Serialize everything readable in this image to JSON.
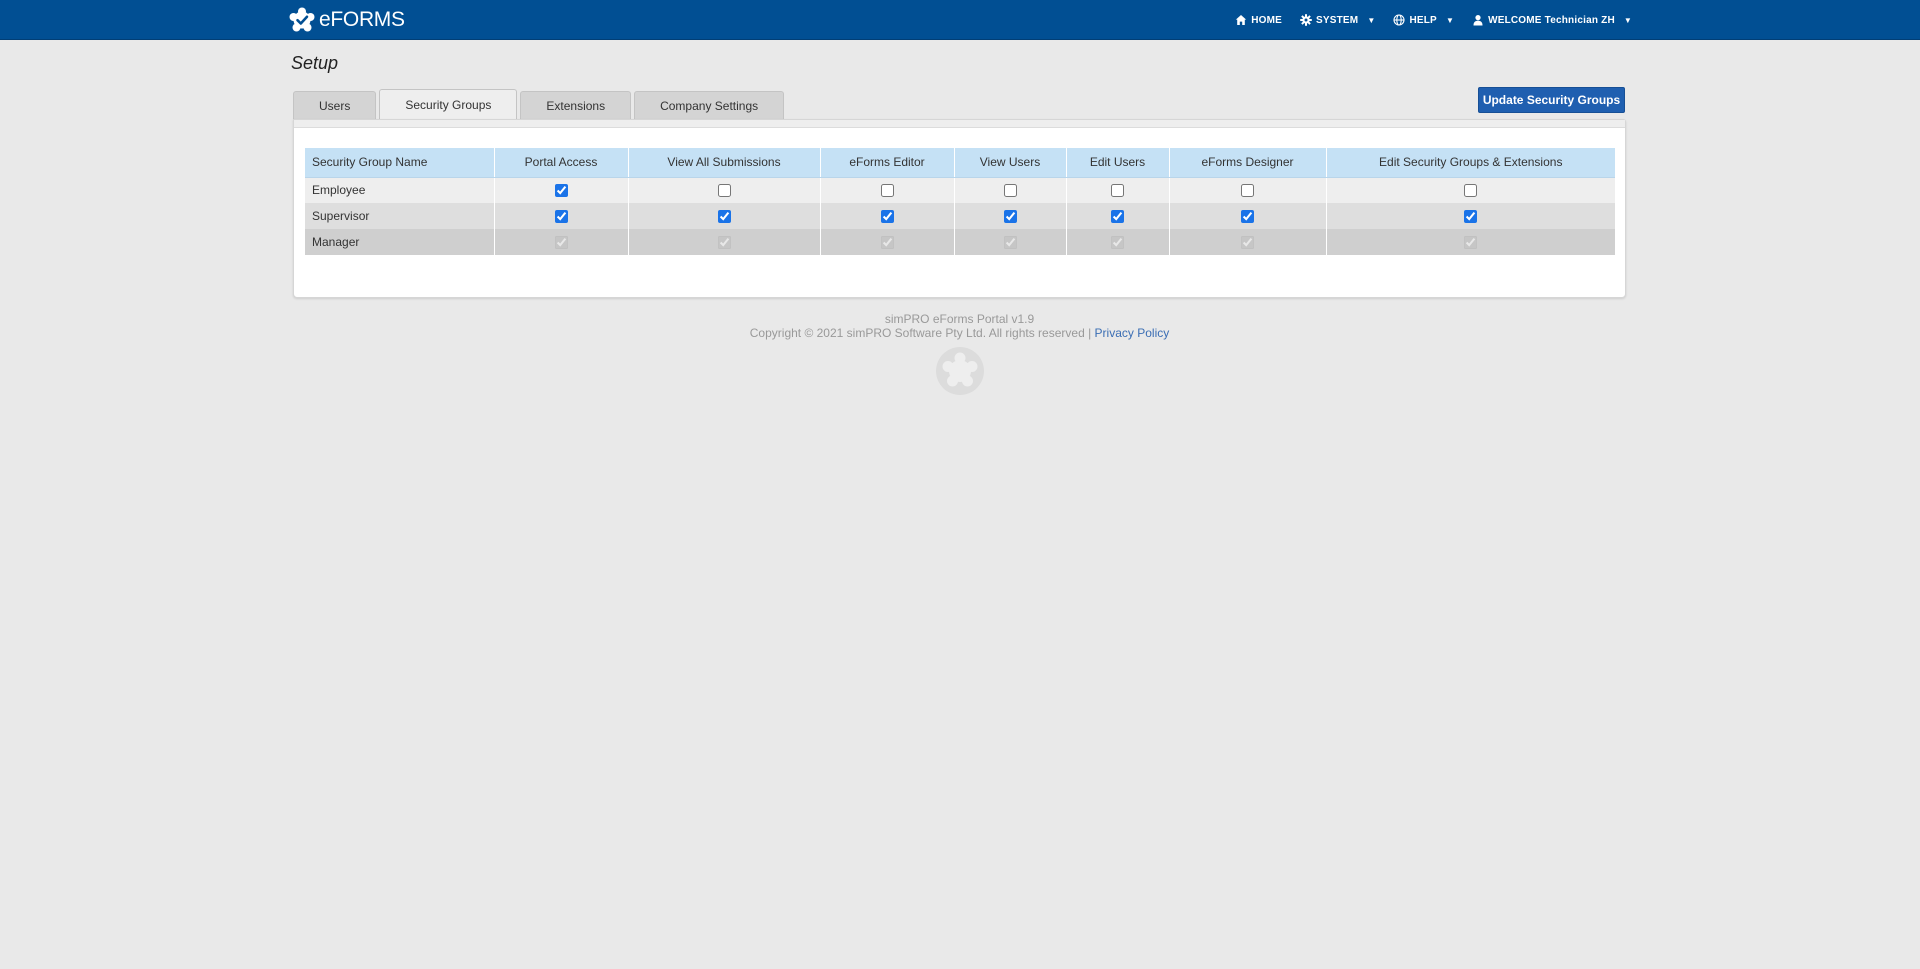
{
  "brand": {
    "name": "eFORMS"
  },
  "nav": {
    "home": "HOME",
    "system": "SYSTEM",
    "help": "HELP",
    "welcome": "WELCOME Technician ZH",
    "caret": "▼"
  },
  "page": {
    "title": "Setup"
  },
  "tabs": [
    {
      "label": "Users",
      "active": false
    },
    {
      "label": "Security Groups",
      "active": true
    },
    {
      "label": "Extensions",
      "active": false
    },
    {
      "label": "Company Settings",
      "active": false
    }
  ],
  "actions": {
    "update_label": "Update Security Groups"
  },
  "table": {
    "headers": [
      "Security Group Name",
      "Portal Access",
      "View All Submissions",
      "eForms Editor",
      "View Users",
      "Edit Users",
      "eForms Designer",
      "Edit Security Groups & Extensions"
    ],
    "rows": [
      {
        "name": "Employee",
        "values": [
          true,
          false,
          false,
          false,
          false,
          false,
          false
        ],
        "disabled": false
      },
      {
        "name": "Supervisor",
        "values": [
          true,
          true,
          true,
          true,
          true,
          true,
          true
        ],
        "disabled": false
      },
      {
        "name": "Manager",
        "values": [
          true,
          true,
          true,
          true,
          true,
          true,
          true
        ],
        "disabled": true
      }
    ]
  },
  "footer": {
    "version": "simPRO eForms Portal v1.9",
    "copyright": "Copyright © 2021 simPRO Software Pty Ltd. All rights reserved |",
    "privacy": "Privacy Policy"
  },
  "colors": {
    "navbar": "#014f93",
    "accent_button": "#1f5fb0",
    "header_row": "#c5e1f5",
    "link": "#3b6eb4"
  },
  "icons": [
    "brand-logo-icon",
    "home-icon",
    "gear-icon",
    "globe-icon",
    "user-icon",
    "footer-logo-icon"
  ]
}
